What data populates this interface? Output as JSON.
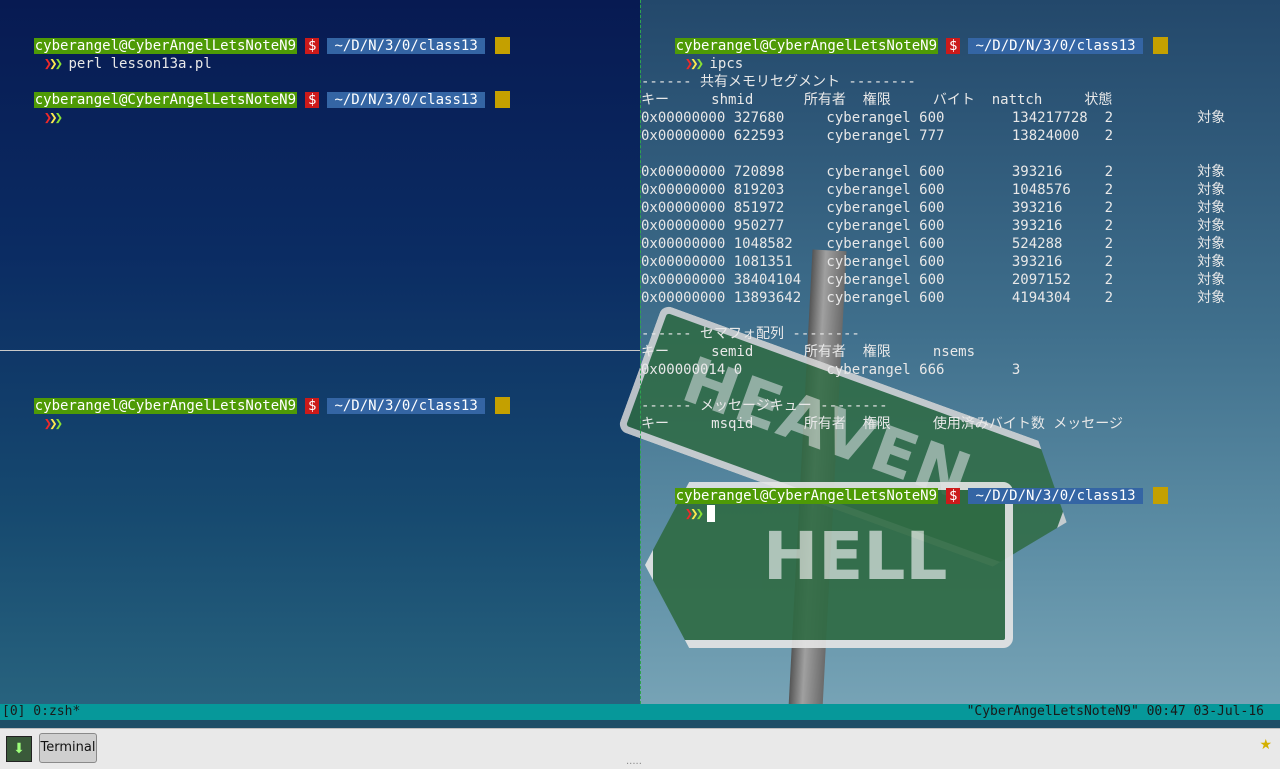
{
  "prompt": {
    "user": "cyberangel@CyberAngelLetsNoteN9",
    "dollar": "$",
    "path_left": "~/D/N/3/0/class13",
    "path_right": "~/D/D/N/3/0/class13",
    "chevrons": "❯❯❯"
  },
  "pane_left_top": {
    "command1": "perl lesson13a.pl"
  },
  "pane_right": {
    "command": "ipcs",
    "lines": [
      "------ 共有メモリセグメント --------",
      "キー     shmid      所有者  権限     バイト  nattch     状態",
      "0x00000000 327680     cyberangel 600        134217728  2          対象",
      "0x00000000 622593     cyberangel 777        13824000   2",
      "",
      "0x00000000 720898     cyberangel 600        393216     2          対象",
      "0x00000000 819203     cyberangel 600        1048576    2          対象",
      "0x00000000 851972     cyberangel 600        393216     2          対象",
      "0x00000000 950277     cyberangel 600        393216     2          対象",
      "0x00000000 1048582    cyberangel 600        524288     2          対象",
      "0x00000000 1081351    cyberangel 600        393216     2          対象",
      "0x00000000 38404104   cyberangel 600        2097152    2          対象",
      "0x00000000 13893642   cyberangel 600        4194304    2          対象",
      "",
      "------ セマフォ配列 --------",
      "キー     semid      所有者  権限     nsems",
      "0x00000014 0          cyberangel 666        3",
      "",
      "------ メッセージキュー --------",
      "キー     msqid      所有者  権限     使用済みバイト数 メッセージ"
    ]
  },
  "wallpaper": {
    "sign_heaven": "HEAVEN",
    "sign_hell": "HELL"
  },
  "statusbar": {
    "left": "[0] 0:zsh*",
    "right": "\"CyberAngelLetsNoteN9\" 00:47 03-Jul-16"
  },
  "taskbar": {
    "task_label": "Terminal",
    "handle": "....."
  },
  "colors": {
    "user_bg": "#4e9a06",
    "dollar_bg": "#cc1a1a",
    "path_bg": "#3465a4",
    "status_bg": "#06989a"
  }
}
